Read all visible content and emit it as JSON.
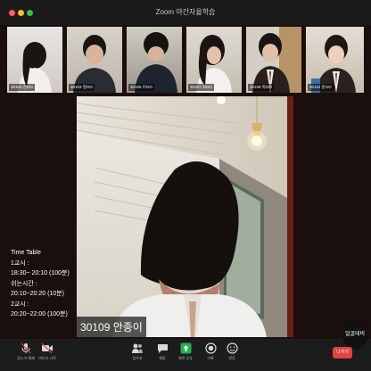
{
  "window": {
    "title": "Zoom 야간자율학습"
  },
  "participants": [
    {
      "name": "30102 김OO"
    },
    {
      "name": "30103 정OO"
    },
    {
      "name": "30105 이OO"
    },
    {
      "name": "30107 최OO"
    },
    {
      "name": "30108 박OO"
    },
    {
      "name": "30110 윤OO"
    }
  ],
  "active_speaker": {
    "name": "30109 안종이"
  },
  "timetable": {
    "title": "Time Table",
    "lines": [
      "1교시 :",
      "18:30~ 20:10 (100분)",
      "쉬는시간 :",
      "20:10~20:20 (10분)",
      "2교시 :",
      "20:20~22:00 (100분)"
    ]
  },
  "toolbar": {
    "mute_label": "음소거 해제",
    "video_label": "비디오 시작",
    "participants_label": "참가자",
    "chat_label": "채팅",
    "share_label": "화면 공유",
    "record_label": "기록",
    "reactions_label": "반응",
    "leave_label": "나가기"
  },
  "pip_label": "얼굴테비",
  "colors": {
    "background": "#1b0f0e",
    "share_green": "#23b14d",
    "leave_red": "#e0443e"
  }
}
